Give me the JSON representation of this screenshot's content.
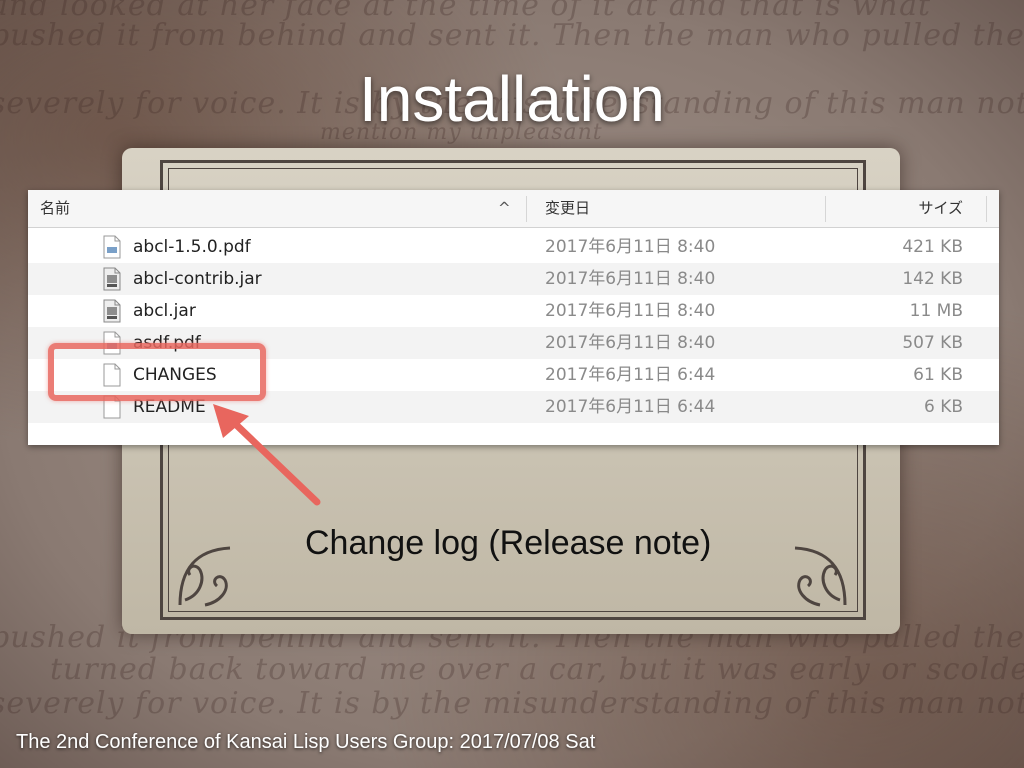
{
  "slide": {
    "title": "Installation",
    "callout": "Change log (Release note)",
    "footer": "The 2nd Conference of Kansai Lisp Users Group: 2017/07/08 Sat"
  },
  "background_text": [
    "and looked at her face at the time of it at and that is what",
    "pushed it from behind and sent it. Then the man who pulled the car",
    "severely for voice. It is by the misunderstanding of this man not to",
    "mention my unpleasant",
    "pushed it from behind and sent it. Then the man who pulled the car",
    "turned back toward me over a car, but it was early or scolded it",
    "severely for voice. It is by the misunderstanding of this man not to"
  ],
  "finder": {
    "columns": {
      "name": "名前",
      "date": "変更日",
      "size": "サイズ"
    },
    "sort_indicator": "^",
    "files": [
      {
        "name": "abcl-1.5.0.pdf",
        "date": "2017年6月11日 8:40",
        "size": "421 KB",
        "icon": "pdf-document-icon"
      },
      {
        "name": "abcl-contrib.jar",
        "date": "2017年6月11日 8:40",
        "size": "142 KB",
        "icon": "jar-archive-icon"
      },
      {
        "name": "abcl.jar",
        "date": "2017年6月11日 8:40",
        "size": "11 MB",
        "icon": "jar-archive-icon"
      },
      {
        "name": "asdf.pdf",
        "date": "2017年6月11日 8:40",
        "size": "507 KB",
        "icon": "pdf-document-icon"
      },
      {
        "name": "CHANGES",
        "date": "2017年6月11日 6:44",
        "size": "61 KB",
        "icon": "text-document-icon"
      },
      {
        "name": "README",
        "date": "2017年6月11日 6:44",
        "size": "6 KB",
        "icon": "text-document-icon"
      }
    ]
  },
  "colors": {
    "highlight": "#e8665e",
    "title": "#ffffff"
  }
}
